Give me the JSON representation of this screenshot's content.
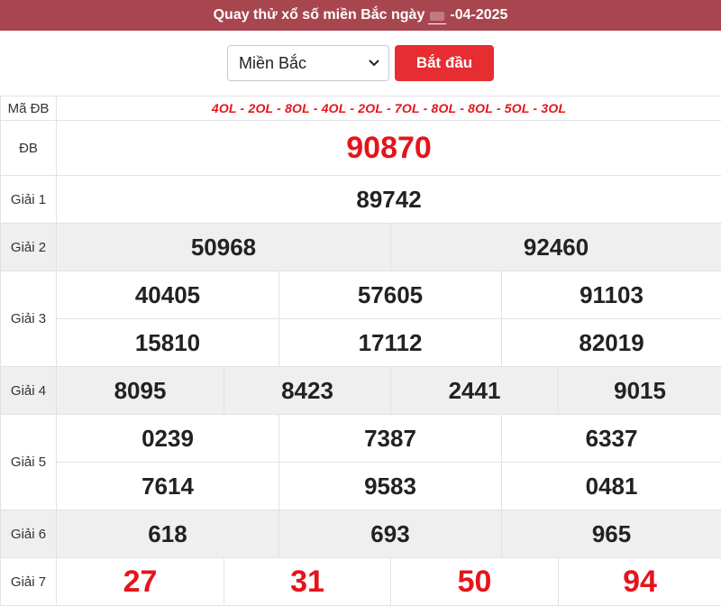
{
  "header": {
    "title_prefix": "Quay thử xổ số miền Bắc ngày",
    "title_suffix": "-04-2025"
  },
  "controls": {
    "region_selected": "Miền Bắc",
    "start_label": "Bắt đầu"
  },
  "table": {
    "code_row": {
      "label": "Mã ĐB",
      "codes": "4OL - 2OL - 8OL - 4OL - 2OL - 7OL - 8OL - 8OL - 5OL - 3OL"
    },
    "special": {
      "label": "ĐB",
      "value": "90870"
    },
    "prize1": {
      "label": "Giải 1",
      "values": [
        "89742"
      ]
    },
    "prize2": {
      "label": "Giải 2",
      "values": [
        "50968",
        "92460"
      ]
    },
    "prize3": {
      "label": "Giải 3",
      "values": [
        "40405",
        "57605",
        "91103",
        "15810",
        "17112",
        "82019"
      ]
    },
    "prize4": {
      "label": "Giải 4",
      "values": [
        "8095",
        "8423",
        "2441",
        "9015"
      ]
    },
    "prize5": {
      "label": "Giải 5",
      "values": [
        "0239",
        "7387",
        "6337",
        "7614",
        "9583",
        "0481"
      ]
    },
    "prize6": {
      "label": "Giải 6",
      "values": [
        "618",
        "693",
        "965"
      ]
    },
    "prize7": {
      "label": "Giải 7",
      "values": [
        "27",
        "31",
        "50",
        "94"
      ]
    }
  },
  "colors": {
    "header_bg": "#a8464f",
    "accent_red": "#e5141c",
    "button_bg": "#e52d32",
    "shade_row": "#efefef"
  },
  "icons": {
    "select_arrow": "chevron-down-icon"
  }
}
